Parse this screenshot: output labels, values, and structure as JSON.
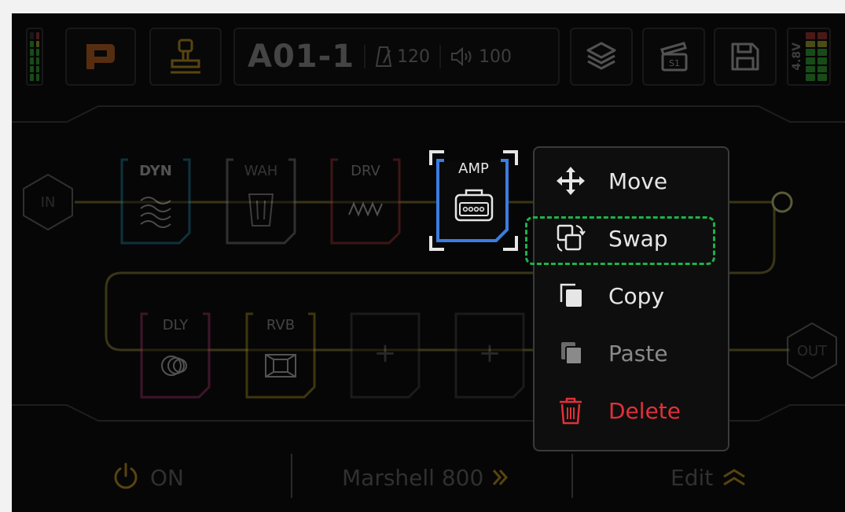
{
  "header": {
    "preset_name": "A01-1",
    "tempo": "120",
    "volume": "100",
    "voltage": "4.8V"
  },
  "chain": {
    "input_label": "IN",
    "output_label": "OUT",
    "blocks_row1": [
      {
        "label": "DYN",
        "color": "#1d6f8c"
      },
      {
        "label": "WAH",
        "color": "#7a7a7a"
      },
      {
        "label": "DRV",
        "color": "#8c2a2a"
      },
      {
        "label": "AMP",
        "color": "#3b7de0"
      }
    ],
    "blocks_row2": [
      {
        "label": "DLY",
        "color": "#8c2a5a"
      },
      {
        "label": "RVB",
        "color": "#8c7a1d"
      },
      {
        "label": "+",
        "color": "#3a3a3a"
      },
      {
        "label": "+",
        "color": "#3a3a3a"
      }
    ]
  },
  "context_menu": {
    "items": [
      {
        "label": "Move",
        "color": "#e6e6e6"
      },
      {
        "label": "Swap",
        "color": "#e6e6e6"
      },
      {
        "label": "Copy",
        "color": "#e6e6e6"
      },
      {
        "label": "Paste",
        "color": "#8a8a8a"
      },
      {
        "label": "Delete",
        "color": "#e0303a"
      }
    ],
    "highlighted": "Swap",
    "highlight_color": "#1fb14a"
  },
  "footer": {
    "power_label": "ON",
    "model_name": "Marshell 800",
    "edit_label": "Edit"
  },
  "colors": {
    "accent_orange": "#c8641e",
    "selection_blue": "#3b7de0",
    "delete_red": "#e0303a"
  }
}
